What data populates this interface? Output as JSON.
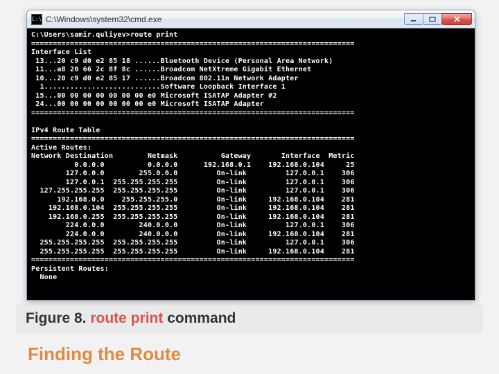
{
  "window": {
    "title": "C:\\Windows\\system32\\cmd.exe",
    "icon_glyph": "C:\\"
  },
  "terminal": {
    "prompt": "C:\\Users\\samir.quliyev>",
    "command": "route print",
    "lines": [
      "C:\\Users\\samir.quliyev>route print",
      "===========================================================================",
      "Interface List",
      " 13...20 c9 d0 e2 85 18 ......Bluetooth Device (Personal Area Network)",
      " 11...a8 20 66 2c 8f 8c ......Broadcom NetXtreme Gigabit Ethernet",
      " 10...20 c9 d0 e2 85 17 ......Broadcom 802.11n Network Adapter",
      "  1...........................Software Loopback Interface 1",
      " 15...00 00 00 00 00 00 00 e0 Microsoft ISATAP Adapter #2",
      " 24...00 00 00 00 00 00 00 e0 Microsoft ISATAP Adapter",
      "===========================================================================",
      "",
      "IPv4 Route Table",
      "===========================================================================",
      "Active Routes:",
      "Network Destination        Netmask          Gateway       Interface  Metric",
      "          0.0.0.0          0.0.0.0      192.168.0.1    192.168.0.104     25",
      "        127.0.0.0        255.0.0.0         On-link         127.0.0.1    306",
      "        127.0.0.1  255.255.255.255         On-link         127.0.0.1    306",
      "  127.255.255.255  255.255.255.255         On-link         127.0.0.1    306",
      "      192.168.0.0    255.255.255.0         On-link     192.168.0.104    281",
      "    192.168.0.104  255.255.255.255         On-link     192.168.0.104    281",
      "    192.168.0.255  255.255.255.255         On-link     192.168.0.104    281",
      "        224.0.0.0        240.0.0.0         On-link         127.0.0.1    306",
      "        224.0.0.0        240.0.0.0         On-link     192.168.0.104    281",
      "  255.255.255.255  255.255.255.255         On-link         127.0.0.1    306",
      "  255.255.255.255  255.255.255.255         On-link     192.168.0.104    281",
      "===========================================================================",
      "Persistent Routes:",
      "  None"
    ]
  },
  "caption": {
    "prefix": "Figure 8. ",
    "highlight": "route print",
    "suffix": " command"
  },
  "slide_title": "Finding the Route"
}
